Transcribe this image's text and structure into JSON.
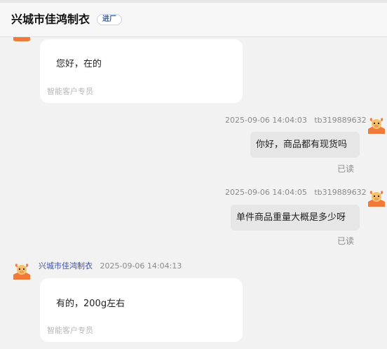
{
  "header": {
    "shop_name": "兴城市佳鸿制衣",
    "badge": "进厂"
  },
  "messages": [
    {
      "side": "left",
      "text": "您好，在的",
      "sub": "智能客户专员"
    },
    {
      "side": "right",
      "time": "2025-09-06 14:04:03",
      "user": "tb319889632",
      "text": "你好，商品都有现货吗",
      "status": "已读"
    },
    {
      "side": "right",
      "time": "2025-09-06 14:04:05",
      "user": "tb319889632",
      "text": "单件商品重量大概是多少呀",
      "status": "已读"
    },
    {
      "side": "left",
      "name": "兴城市佳鸿制衣",
      "time": "2025-09-06 14:04:13",
      "text": "有的，200g左右",
      "sub": "智能客户专员"
    }
  ],
  "icons": {
    "shop_avatar": "cartoon-bull-avatar",
    "user_avatar": "cartoon-bull-avatar"
  },
  "colors": {
    "accent_name": "#3b4ea8",
    "avatar_orange": "#f07a3a"
  }
}
